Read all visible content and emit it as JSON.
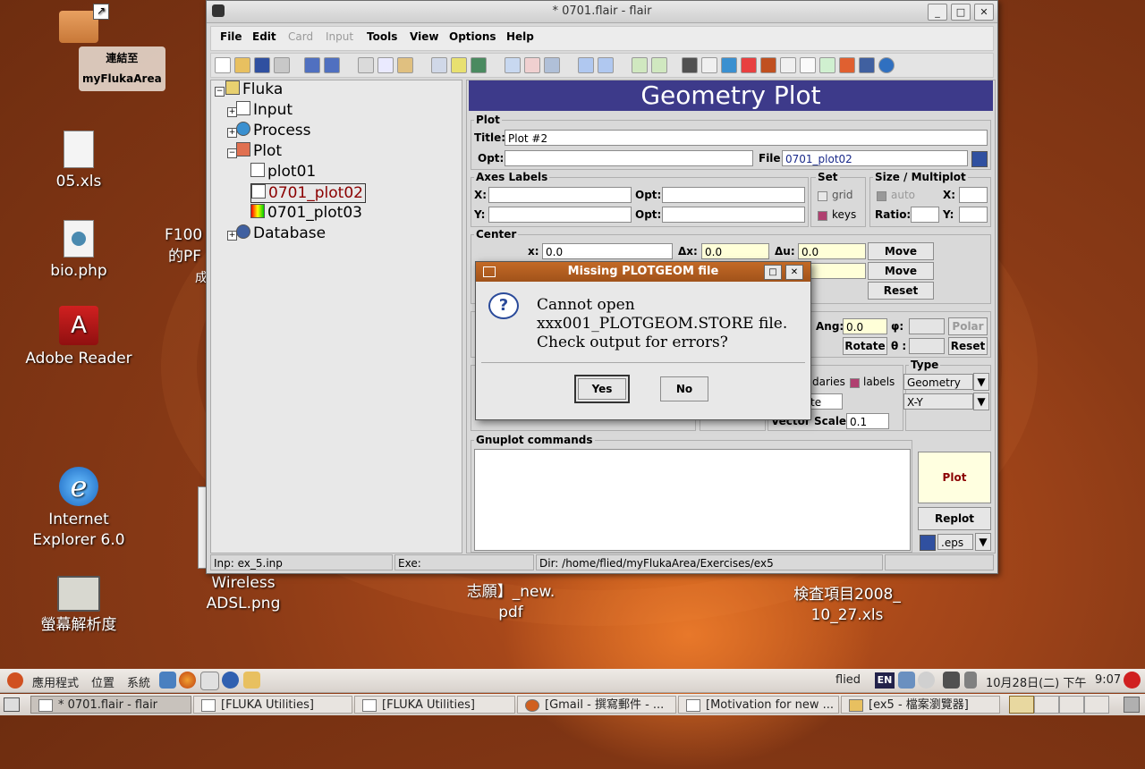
{
  "desktop": {
    "icons": [
      {
        "label": "連結至\nmyFlukaArea"
      },
      {
        "label": "05.xls"
      },
      {
        "label": "bio.php"
      },
      {
        "label": "Adobe Reader"
      },
      {
        "label": "Internet\nExplorer 6.0"
      },
      {
        "label": "螢幕解析度"
      }
    ],
    "partial_texts": {
      "f100": "F100",
      "pf": "的PF",
      "cheng": "成",
      "wireless": "Wireless\nADSL.png",
      "zhiyuan": "志願】_new.\npdf",
      "jiancha": "検査項目2008_\n10_27.xls"
    }
  },
  "window": {
    "title": "* 0701.flair - flair",
    "buttons": {
      "minimize": "_",
      "maximize": "□",
      "close": "✕"
    },
    "menu": [
      "File",
      "Edit",
      "Card",
      "Input",
      "Tools",
      "View",
      "Options",
      "Help"
    ],
    "tree": {
      "root": "Fluka",
      "items": [
        "Input",
        "Process",
        "Plot",
        "plot01",
        "0701_plot02",
        "0701_plot03",
        "Database"
      ]
    },
    "panel": {
      "header": "Geometry Plot",
      "plot": {
        "legend": "Plot",
        "title_label": "Title:",
        "title_value": "Plot #2",
        "opt_label": "Opt:",
        "file_label": "File:",
        "file_value": "0701_plot02"
      },
      "axes": {
        "legend": "Axes Labels",
        "x_label": "X:",
        "y_label": "Y:",
        "opt1": "Opt:",
        "opt2": "Opt:"
      },
      "set": {
        "legend": "Set",
        "grid": "grid",
        "keys": "keys"
      },
      "size": {
        "legend": "Size / Multiplot",
        "auto": "auto",
        "x": "X:",
        "ratio": "Ratio:",
        "y": "Y:"
      },
      "center": {
        "legend": "Center",
        "x_label": "x:",
        "x_value": "0.0",
        "dx_label": "Δx:",
        "dx_value": "0.0",
        "du_label": "Δu:",
        "du_value": "0.0",
        "second_value": "0",
        "move": "Move",
        "move_uv": "Move [u,v]",
        "reset": "Reset"
      },
      "rotate": {
        "ang_label": "Ang:",
        "ang_value": "0.0",
        "phi_label": "φ:",
        "polar": "Polar",
        "rotate": "Rotate",
        "theta_label": "θ :",
        "reset": "Reset"
      },
      "options": {
        "boundaries": "daries",
        "labels": "labels",
        "partial": "te",
        "vector_scale_label": "Vector Scale:",
        "vector_scale_value": "0.1"
      },
      "type": {
        "legend": "Type",
        "value1": "Geometry",
        "value2": "X-Y"
      },
      "gnuplot": {
        "legend": "Gnuplot commands"
      },
      "plot_button": "Plot",
      "replot_button": "Replot",
      "format": ".eps"
    },
    "status": {
      "inp": "Inp: ex_5.inp",
      "exe": "Exe:",
      "dir": "Dir: /home/flied/myFlukaArea/Exercises/ex5"
    }
  },
  "dialog": {
    "title": "Missing PLOTGEOM file",
    "message": [
      "Cannot open",
      "xxx001_PLOTGEOM.STORE file.",
      "Check output for errors?"
    ],
    "yes": "Yes",
    "no": "No"
  },
  "top_panel": {
    "apps": "應用程式",
    "places": "位置",
    "system": "系統",
    "user": "flied",
    "lang": "EN",
    "date": "10月28日(二) 下午",
    "time": "9:07"
  },
  "taskbar": [
    "* 0701.flair - flair",
    "[FLUKA Utilities]",
    "[FLUKA Utilities]",
    "[Gmail - 撰寫郵件 - ...",
    "[Motivation for new ...",
    "[ex5 - 檔案瀏覽器]"
  ],
  "colors": {
    "header": "#3d3a8a",
    "dialog_title": "#b05c1e",
    "selected_plot": "#8b0000"
  }
}
